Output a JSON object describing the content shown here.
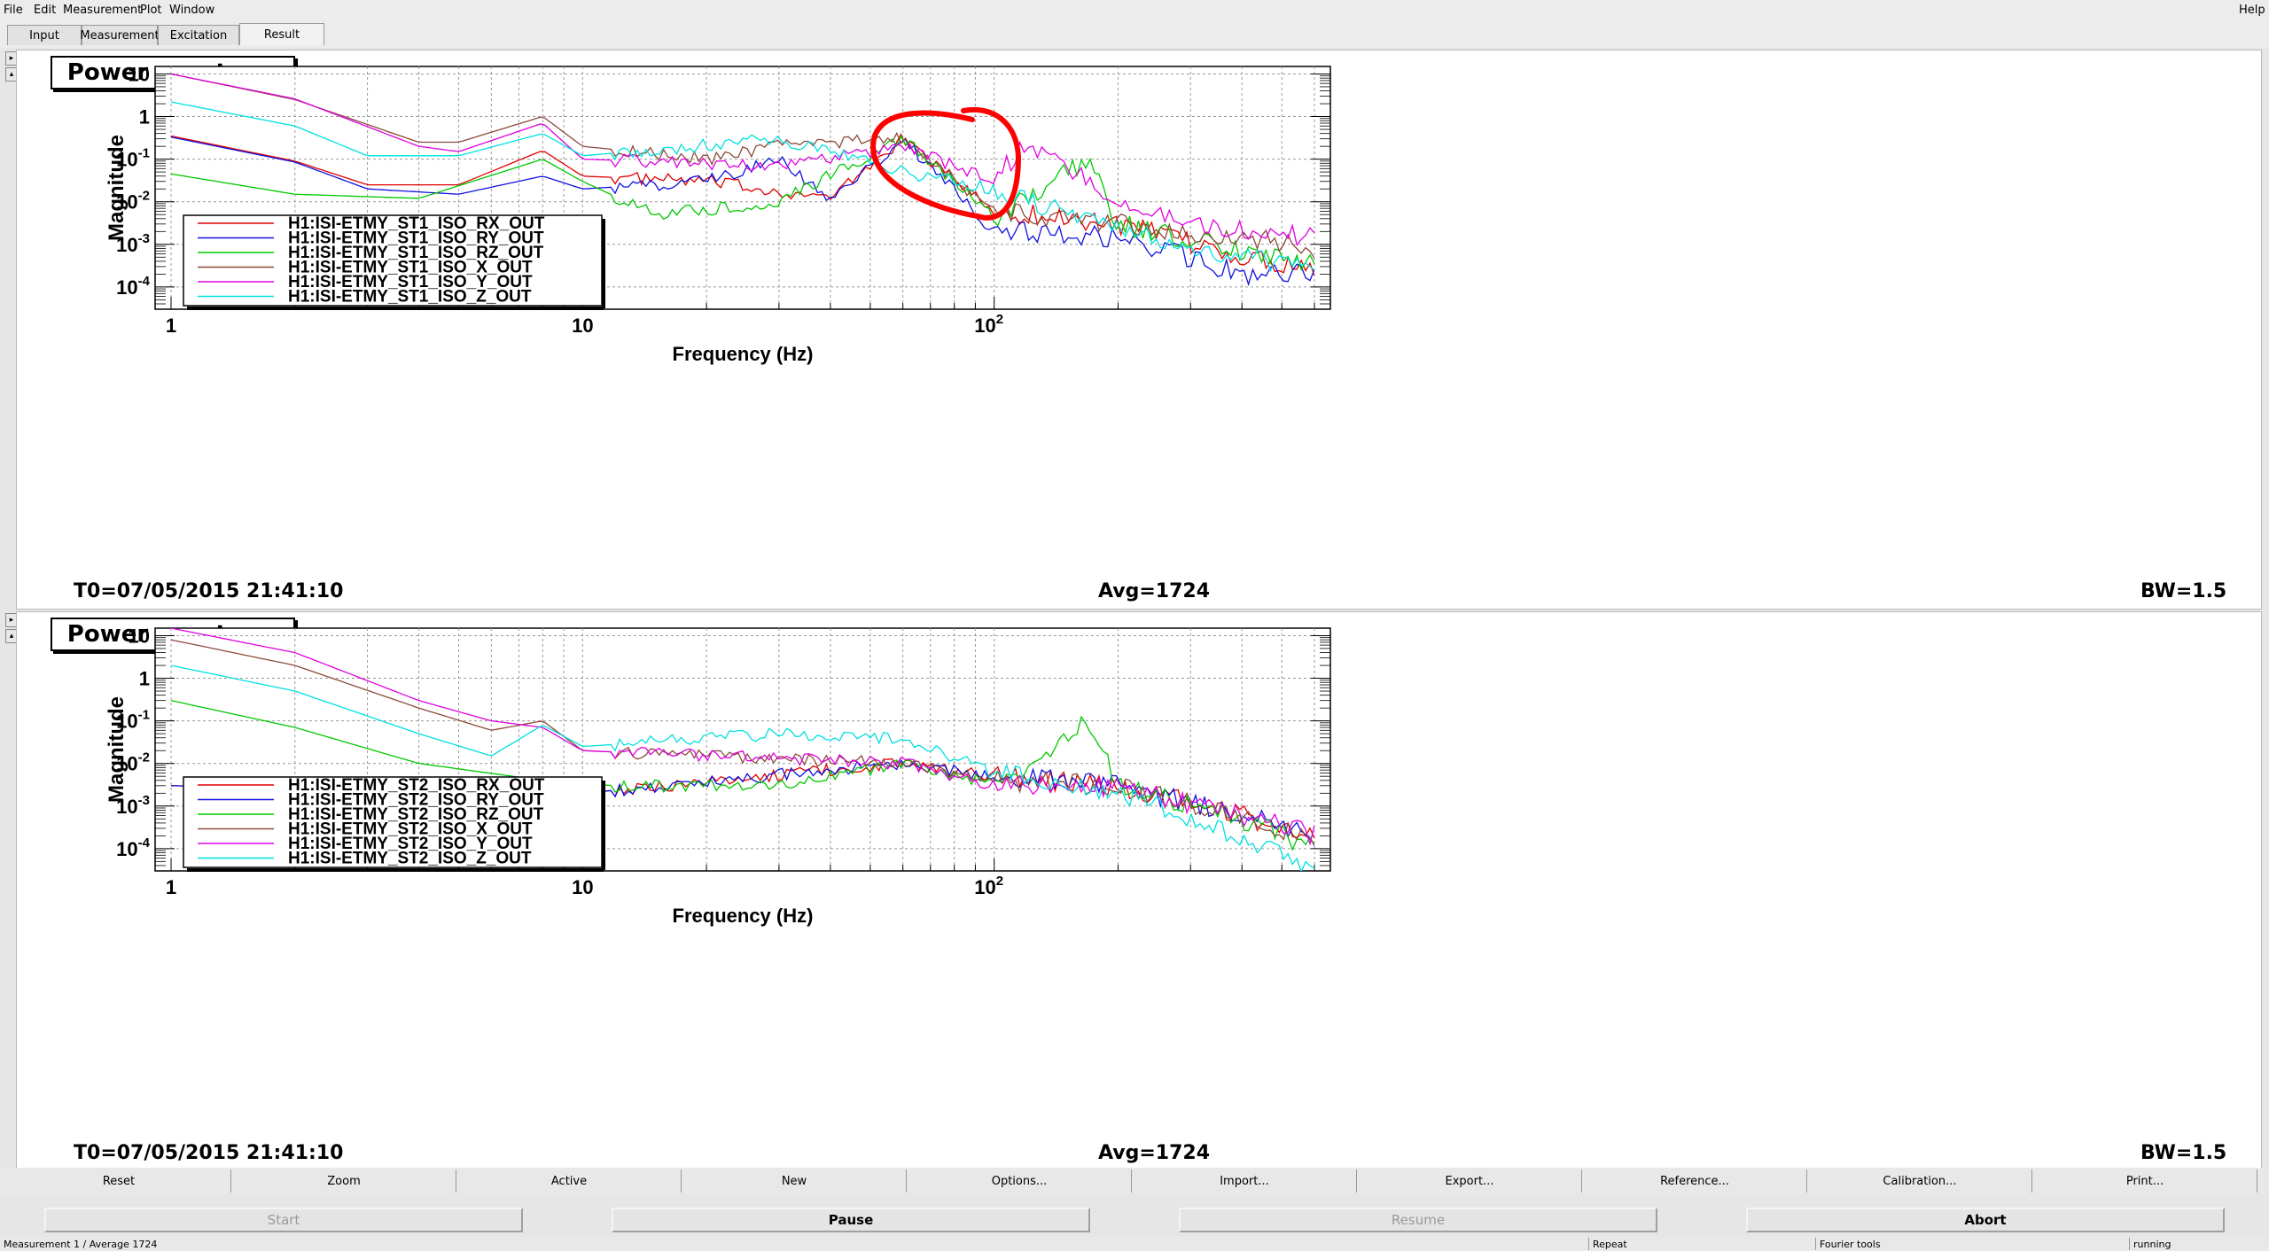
{
  "menu": {
    "file": "File",
    "edit": "Edit",
    "measurement": "Measurement",
    "plot": "Plot",
    "window": "Window",
    "help": "Help"
  },
  "tabs": [
    "Input",
    "Measurement",
    "Excitation",
    "Result"
  ],
  "active_tab": "Result",
  "panels": [
    {
      "title": "Power spectrum",
      "t0": "T0=07/05/2015 21:41:10",
      "avg": "Avg=1724",
      "bw": "BW=1.5",
      "ylabel": "Magnitude",
      "xlabel": "Frequency (Hz)",
      "ytick_labels": [
        "10",
        "1",
        "10",
        "10",
        "10",
        "10"
      ],
      "ytick_exps": [
        "",
        "",
        "-1",
        "-2",
        "-3",
        "-4"
      ],
      "xtick_labels": [
        "1",
        "10",
        "10"
      ],
      "xtick_exps": [
        "",
        "",
        "2"
      ],
      "legend": [
        "H1:ISI-ETMY_ST1_ISO_RX_OUT",
        "H1:ISI-ETMY_ST1_ISO_RY_OUT",
        "H1:ISI-ETMY_ST1_ISO_RZ_OUT",
        "H1:ISI-ETMY_ST1_ISO_X_OUT",
        "H1:ISI-ETMY_ST1_ISO_Y_OUT",
        "H1:ISI-ETMY_ST1_ISO_Z_OUT"
      ]
    },
    {
      "title": "Power spectrum",
      "t0": "T0=07/05/2015 21:41:10",
      "avg": "Avg=1724",
      "bw": "BW=1.5",
      "ylabel": "Magnitude",
      "xlabel": "Frequency (Hz)",
      "ytick_labels": [
        "10",
        "1",
        "10",
        "10",
        "10"
      ],
      "ytick_exps": [
        "",
        "",
        "-1",
        "-2",
        "-3",
        "-4"
      ],
      "xtick_labels": [
        "1",
        "10",
        "10"
      ],
      "xtick_exps": [
        "",
        "",
        "2"
      ],
      "legend": [
        "H1:ISI-ETMY_ST2_ISO_RX_OUT",
        "H1:ISI-ETMY_ST2_ISO_RY_OUT",
        "H1:ISI-ETMY_ST2_ISO_RZ_OUT",
        "H1:ISI-ETMY_ST2_ISO_X_OUT",
        "H1:ISI-ETMY_ST2_ISO_Y_OUT",
        "H1:ISI-ETMY_ST2_ISO_Z_OUT"
      ]
    }
  ],
  "buttons_row1": [
    "Reset",
    "Zoom",
    "Active",
    "New",
    "Options...",
    "Import...",
    "Export...",
    "Reference...",
    "Calibration...",
    "Print..."
  ],
  "buttons_row2": [
    {
      "label": "Start",
      "enabled": false
    },
    {
      "label": "Pause",
      "enabled": true
    },
    {
      "label": "Resume",
      "enabled": false
    },
    {
      "label": "Abort",
      "enabled": true
    }
  ],
  "status": {
    "measurement": "Measurement 1 / Average 1724",
    "repeat": "Repeat",
    "tools": "Fourier tools",
    "state": "running"
  },
  "colors": {
    "RX": "#e00000",
    "RY": "#1010e0",
    "RZ": "#00c800",
    "X": "#8b4a3a",
    "Y": "#e000e0",
    "Z": "#00e0e0",
    "annotation": "#ff0000"
  },
  "chart_data": [
    {
      "type": "line",
      "title": "Power spectrum",
      "xlabel": "Frequency (Hz)",
      "ylabel": "Magnitude",
      "xscale": "log",
      "yscale": "log",
      "xlim": [
        1,
        600
      ],
      "ylim": [
        3e-05,
        15
      ],
      "grid": true,
      "legend_position": "bottom-left",
      "series": [
        {
          "name": "H1:ISI-ETMY_ST1_ISO_RX_OUT",
          "points": [
            [
              1,
              0.35
            ],
            [
              2,
              0.09
            ],
            [
              3,
              0.025
            ],
            [
              5,
              0.025
            ],
            [
              8,
              0.16
            ],
            [
              10,
              0.04
            ],
            [
              20,
              0.03
            ],
            [
              40,
              0.012
            ],
            [
              60,
              0.3
            ],
            [
              100,
              0.006
            ],
            [
              200,
              0.003
            ],
            [
              400,
              0.0005
            ],
            [
              600,
              0.0003
            ]
          ]
        },
        {
          "name": "H1:ISI-ETMY_ST1_ISO_RY_OUT",
          "points": [
            [
              1,
              0.33
            ],
            [
              2,
              0.085
            ],
            [
              3,
              0.02
            ],
            [
              5,
              0.015
            ],
            [
              8,
              0.04
            ],
            [
              10,
              0.02
            ],
            [
              20,
              0.03
            ],
            [
              30,
              0.1
            ],
            [
              40,
              0.01
            ],
            [
              60,
              0.3
            ],
            [
              100,
              0.002
            ],
            [
              200,
              0.0015
            ],
            [
              400,
              0.0002
            ],
            [
              600,
              0.0002
            ]
          ]
        },
        {
          "name": "H1:ISI-ETMY_ST1_ISO_RZ_OUT",
          "points": [
            [
              1,
              0.045
            ],
            [
              2,
              0.015
            ],
            [
              4,
              0.012
            ],
            [
              8,
              0.1
            ],
            [
              10,
              0.03
            ],
            [
              15,
              0.005
            ],
            [
              30,
              0.01
            ],
            [
              60,
              0.3
            ],
            [
              100,
              0.004
            ],
            [
              170,
              0.1
            ],
            [
              200,
              0.003
            ],
            [
              400,
              0.0007
            ],
            [
              600,
              0.0004
            ]
          ]
        },
        {
          "name": "H1:ISI-ETMY_ST1_ISO_X_OUT",
          "points": [
            [
              1,
              10
            ],
            [
              2,
              2.5
            ],
            [
              4,
              0.25
            ],
            [
              5,
              0.25
            ],
            [
              8,
              1
            ],
            [
              10,
              0.2
            ],
            [
              20,
              0.1
            ],
            [
              30,
              0.2
            ],
            [
              60,
              0.3
            ],
            [
              100,
              0.006
            ],
            [
              200,
              0.003
            ],
            [
              400,
              0.0015
            ],
            [
              600,
              0.0008
            ]
          ]
        },
        {
          "name": "H1:ISI-ETMY_ST1_ISO_Y_OUT",
          "points": [
            [
              1,
              10
            ],
            [
              2,
              2.6
            ],
            [
              4,
              0.2
            ],
            [
              5,
              0.15
            ],
            [
              8,
              0.7
            ],
            [
              10,
              0.1
            ],
            [
              30,
              0.07
            ],
            [
              60,
              0.2
            ],
            [
              100,
              0.03
            ],
            [
              120,
              0.25
            ],
            [
              200,
              0.01
            ],
            [
              400,
              0.002
            ],
            [
              600,
              0.0015
            ]
          ]
        },
        {
          "name": "H1:ISI-ETMY_ST1_ISO_Z_OUT",
          "points": [
            [
              1,
              2.2
            ],
            [
              2,
              0.6
            ],
            [
              3,
              0.12
            ],
            [
              5,
              0.12
            ],
            [
              8,
              0.4
            ],
            [
              10,
              0.12
            ],
            [
              30,
              0.3
            ],
            [
              60,
              0.05
            ],
            [
              100,
              0.02
            ],
            [
              200,
              0.002
            ],
            [
              400,
              0.0005
            ],
            [
              600,
              0.0003
            ]
          ]
        }
      ]
    },
    {
      "type": "line",
      "title": "Power spectrum",
      "xlabel": "Frequency (Hz)",
      "ylabel": "Magnitude",
      "xscale": "log",
      "yscale": "log",
      "xlim": [
        1,
        600
      ],
      "ylim": [
        3e-05,
        15
      ],
      "grid": true,
      "legend_position": "bottom-left",
      "series": [
        {
          "name": "H1:ISI-ETMY_ST2_ISO_RX_OUT",
          "points": [
            [
              1,
              0.003
            ],
            [
              10,
              0.002
            ],
            [
              60,
              0.01
            ],
            [
              100,
              0.005
            ],
            [
              200,
              0.003
            ],
            [
              400,
              0.0006
            ],
            [
              600,
              0.0002
            ]
          ]
        },
        {
          "name": "H1:ISI-ETMY_ST2_ISO_RY_OUT",
          "points": [
            [
              1,
              0.003
            ],
            [
              10,
              0.002
            ],
            [
              60,
              0.01
            ],
            [
              100,
              0.005
            ],
            [
              200,
              0.003
            ],
            [
              400,
              0.0006
            ],
            [
              600,
              0.0002
            ]
          ]
        },
        {
          "name": "H1:ISI-ETMY_ST2_ISO_RZ_OUT",
          "points": [
            [
              1,
              0.3
            ],
            [
              2,
              0.07
            ],
            [
              4,
              0.01
            ],
            [
              8,
              0.004
            ],
            [
              12,
              0.003
            ],
            [
              30,
              0.003
            ],
            [
              60,
              0.01
            ],
            [
              100,
              0.003
            ],
            [
              170,
              0.1
            ],
            [
              200,
              0.003
            ],
            [
              400,
              0.0005
            ],
            [
              600,
              0.0001
            ]
          ]
        },
        {
          "name": "H1:ISI-ETMY_ST2_ISO_X_OUT",
          "points": [
            [
              1,
              8
            ],
            [
              2,
              2
            ],
            [
              4,
              0.2
            ],
            [
              6,
              0.06
            ],
            [
              8,
              0.1
            ],
            [
              10,
              0.02
            ],
            [
              20,
              0.015
            ],
            [
              60,
              0.01
            ],
            [
              100,
              0.004
            ],
            [
              200,
              0.003
            ],
            [
              400,
              0.0006
            ],
            [
              600,
              0.00015
            ]
          ]
        },
        {
          "name": "H1:ISI-ETMY_ST2_ISO_Y_OUT",
          "points": [
            [
              1,
              15
            ],
            [
              2,
              4
            ],
            [
              4,
              0.3
            ],
            [
              6,
              0.1
            ],
            [
              8,
              0.07
            ],
            [
              10,
              0.02
            ],
            [
              20,
              0.015
            ],
            [
              60,
              0.01
            ],
            [
              100,
              0.003
            ],
            [
              200,
              0.003
            ],
            [
              400,
              0.0006
            ],
            [
              600,
              0.0002
            ]
          ]
        },
        {
          "name": "H1:ISI-ETMY_ST2_ISO_Z_OUT",
          "points": [
            [
              1,
              2
            ],
            [
              2,
              0.5
            ],
            [
              4,
              0.05
            ],
            [
              6,
              0.015
            ],
            [
              8,
              0.08
            ],
            [
              10,
              0.025
            ],
            [
              30,
              0.05
            ],
            [
              60,
              0.04
            ],
            [
              100,
              0.006
            ],
            [
              200,
              0.002
            ],
            [
              400,
              0.0002
            ],
            [
              600,
              3e-05
            ]
          ]
        }
      ]
    }
  ]
}
